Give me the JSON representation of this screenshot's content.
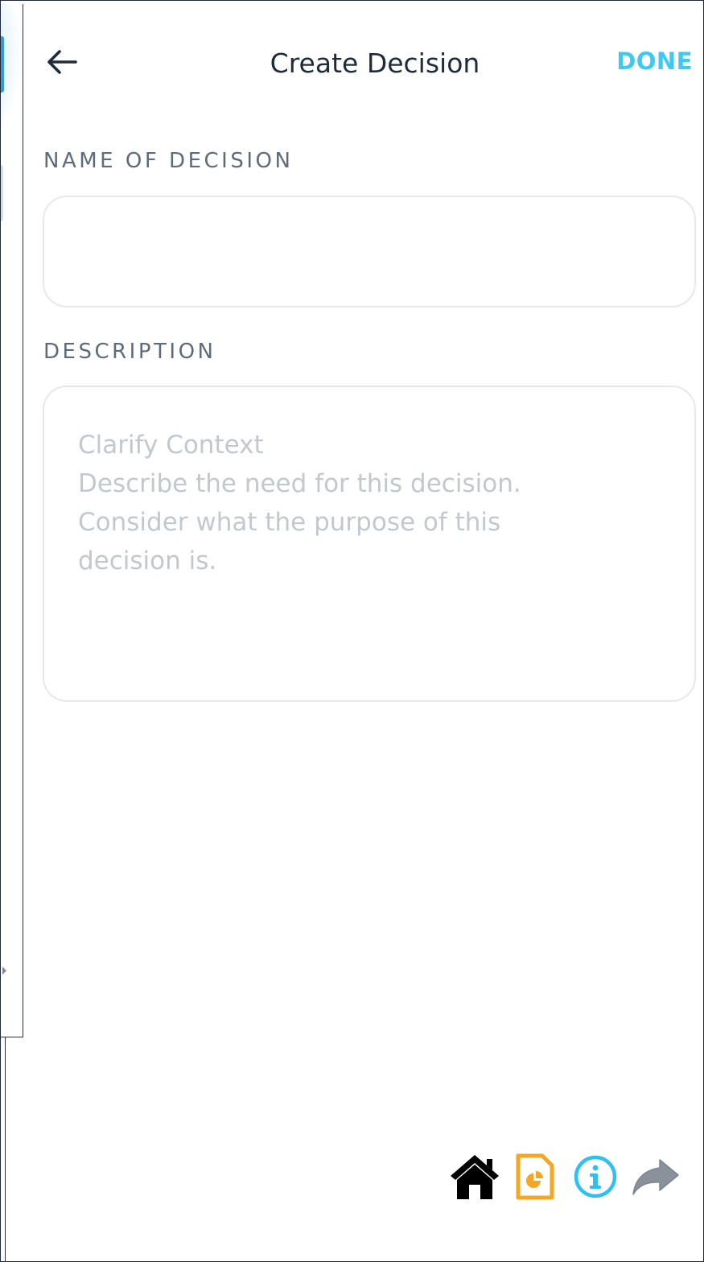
{
  "header": {
    "back_label": "Back",
    "title": "Create Decision",
    "done_label": "DONE"
  },
  "form": {
    "name_label": "NAME OF DECISION",
    "name_value": "",
    "name_placeholder": "",
    "description_label": "DESCRIPTION",
    "description_value": "",
    "description_placeholder": "Clarify Context\nDescribe the need for this decision.\nConsider what the purpose of this\ndecision is."
  },
  "toolbar": {
    "items": [
      {
        "icon": "home-icon",
        "color": "#000000"
      },
      {
        "icon": "report-icon",
        "color": "#f5a623"
      },
      {
        "icon": "info-icon",
        "color": "#2ec0ee"
      },
      {
        "icon": "share-icon",
        "color": "#7d8591"
      }
    ]
  },
  "colors": {
    "accent": "#3ccaf2",
    "title": "#1d2b3a",
    "label": "#5d6b7b",
    "placeholder": "#c3c8ce",
    "field_border": "#e6e8eb"
  }
}
